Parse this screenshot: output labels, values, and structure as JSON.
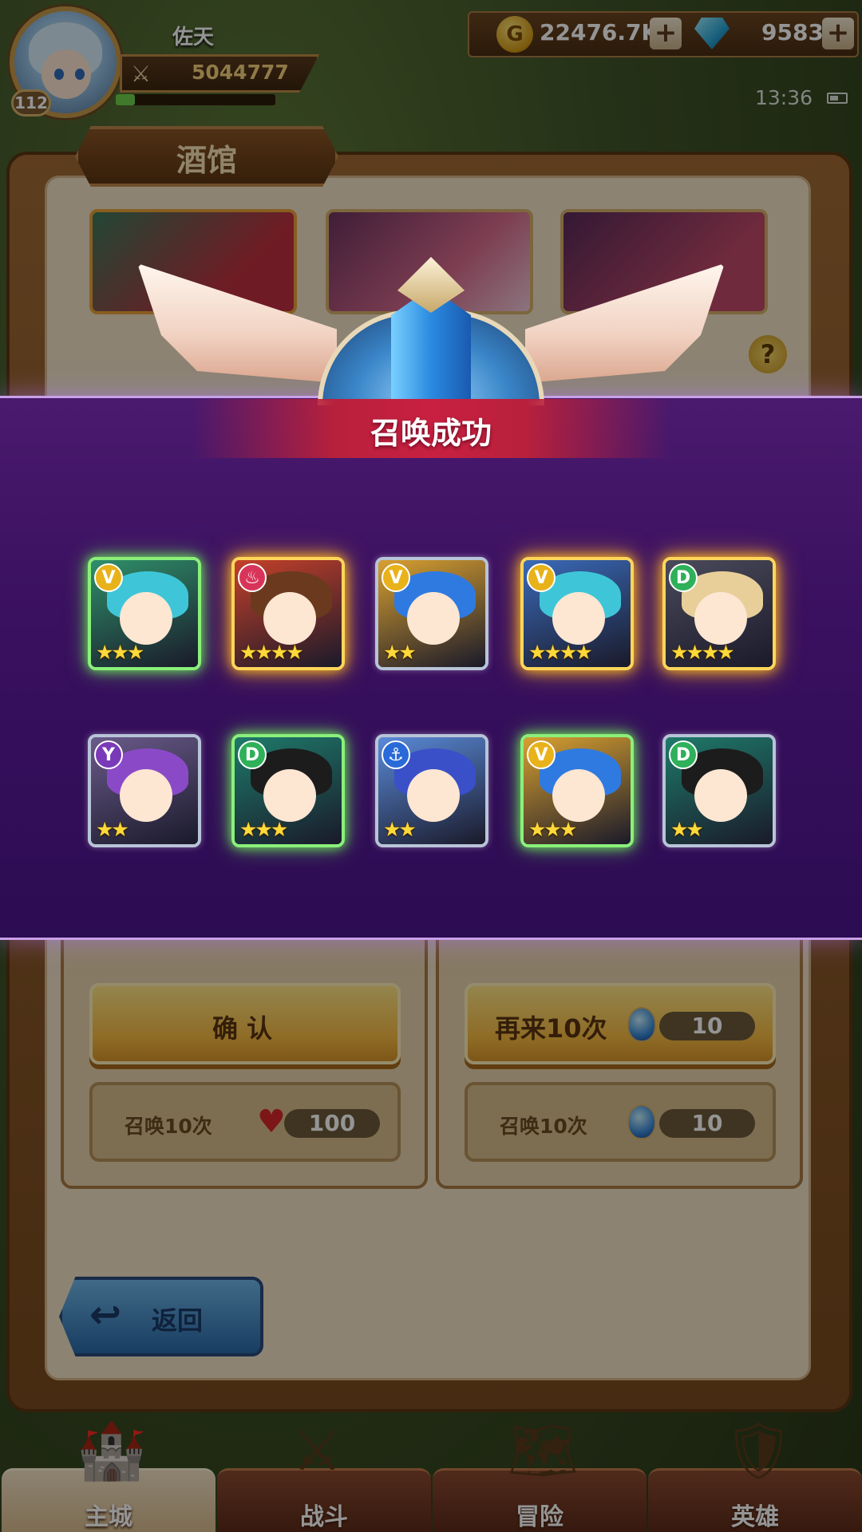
{
  "player": {
    "name": "佐天",
    "level": "112",
    "power": "5044777",
    "power_icon": "crossed-swords-icon"
  },
  "resources": {
    "gold": "22476.7K",
    "gems": "9583",
    "gold_icon": "coin-icon",
    "gem_icon": "gem-icon",
    "plus": "+"
  },
  "status": {
    "time": "13:36"
  },
  "tavern": {
    "title": "酒馆",
    "help_label": "?",
    "confirm_label": "确 认",
    "again_label": "再来10次",
    "again_cost": "10",
    "summon_left_label": "召唤10次",
    "summon_left_cost": "100",
    "summon_right_label": "召唤10次",
    "summon_right_cost": "10",
    "back_label": "返回"
  },
  "modal": {
    "title": "召唤成功",
    "heroes": [
      {
        "faction": "V",
        "faction_color": "#e8b21a",
        "stars": "★★★",
        "hair": "#3ec6d8",
        "bg": "#2f8f6a",
        "rarity": "r3"
      },
      {
        "faction": "♨",
        "faction_color": "#d8345a",
        "stars": "★★★★",
        "hair": "#6b3a1e",
        "bg": "#c4402a",
        "rarity": "r4"
      },
      {
        "faction": "V",
        "faction_color": "#e8b21a",
        "stars": "★★",
        "hair": "#2f7ae0",
        "bg": "#d8a030",
        "rarity": "r2"
      },
      {
        "faction": "V",
        "faction_color": "#e8b21a",
        "stars": "★★★★",
        "hair": "#3ec6d8",
        "bg": "#3a6ab8",
        "rarity": "r4"
      },
      {
        "faction": "D",
        "faction_color": "#2fb05a",
        "stars": "★★★★",
        "hair": "#e8cf9a",
        "bg": "#4a4a5a",
        "rarity": "r4"
      },
      {
        "faction": "Y",
        "faction_color": "#7a3ab8",
        "stars": "★★",
        "hair": "#8a4ac8",
        "bg": "#6a5a8a",
        "rarity": "r2"
      },
      {
        "faction": "D",
        "faction_color": "#2fb05a",
        "stars": "★★★",
        "hair": "#1c1c1c",
        "bg": "#1e7a6a",
        "rarity": "r3"
      },
      {
        "faction": "⚓",
        "faction_color": "#2a6ad8",
        "stars": "★★",
        "hair": "#3a50c8",
        "bg": "#5a8ad8",
        "rarity": "r2"
      },
      {
        "faction": "V",
        "faction_color": "#e8b21a",
        "stars": "★★★",
        "hair": "#2f7ae0",
        "bg": "#d8a030",
        "rarity": "r3"
      },
      {
        "faction": "D",
        "faction_color": "#2fb05a",
        "stars": "★★",
        "hair": "#1c1c1c",
        "bg": "#1e7a6a",
        "rarity": "r2"
      }
    ]
  },
  "nav": {
    "tabs": [
      {
        "label": "主城",
        "icon": "castle-icon",
        "glyph": "🏰",
        "active": true
      },
      {
        "label": "战斗",
        "icon": "swords-icon",
        "glyph": "⚔",
        "active": false
      },
      {
        "label": "冒险",
        "icon": "map-icon",
        "glyph": "🗺",
        "active": false
      },
      {
        "label": "英雄",
        "icon": "shield-icon",
        "glyph": "🛡",
        "active": false
      }
    ]
  }
}
